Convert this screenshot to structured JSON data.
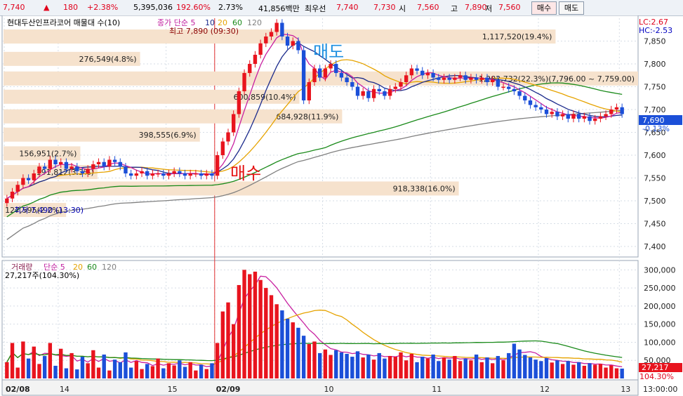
{
  "quote": {
    "price": "7,740",
    "direction": "▲",
    "change": "180",
    "change_pct": "+2.38%",
    "volume": "5,395,036",
    "volume_ratio": "192.60%",
    "turnover": "2.73%",
    "amount": "41,856백만",
    "best_label": "최우선",
    "best_ask": "7,740",
    "best_bid": "7,730",
    "open_label": "시",
    "open": "7,560",
    "high_label": "고",
    "high": "7,890",
    "low_label": "저",
    "low": "7,560"
  },
  "buttons": {
    "sell": "매수",
    "buy": "매도"
  },
  "price_panel": {
    "title": "현대두산인프라코어 매물대 수(10)",
    "ma_label": "종가 단순 5",
    "ma_periods": [
      "10",
      "20",
      "60",
      "120"
    ],
    "high_note": "최고 7,890 (09:30)",
    "low_note": "최저 7,490 (13:30)",
    "lc": "LC:2.67",
    "hc": "HC:-2.53",
    "current_price_tag": "7,690",
    "current_pct_tag": "-0.13%",
    "annotation_sell": "매도",
    "annotation_buy": "매수",
    "y_ticks": [
      "7,850",
      "7,800",
      "7,750",
      "7,700",
      "7,650",
      "7,600",
      "7,550",
      "7,500",
      "7,450",
      "7,400"
    ]
  },
  "volume_panel": {
    "title": "거래량",
    "ma_label": "단순 5",
    "ma_periods": [
      "20",
      "60",
      "120"
    ],
    "current_text": "27,217주(104.30%)",
    "tag_value": "27,217",
    "tag_pct": "104.30%",
    "y_ticks": [
      "300,000",
      "250,000",
      "200,000",
      "150,000",
      "100,000",
      "50,000"
    ]
  },
  "x_ticks": [
    "02/08",
    "14",
    "15",
    "02/09",
    "10",
    "11",
    "12",
    "13",
    "13:00:00"
  ],
  "colors": {
    "up": "#e8141e",
    "down": "#1b4fd8",
    "ma5": "#c820a0",
    "ma10": "#1c2b8c",
    "ma20": "#e6a300",
    "ma60": "#1a8a1a",
    "ma120": "#808080",
    "profile": "#f6e2cd"
  },
  "chart_data": {
    "type": "candlestick",
    "x_range": [
      "02/08",
      "13"
    ],
    "price_ylim": [
      7380,
      7900
    ],
    "volume_ylim": [
      0,
      320000
    ],
    "volume_profile": [
      {
        "label": "1,117,520(19.4%)",
        "price": 7860,
        "share_pct": 19.4
      },
      {
        "label": "276,549(4.8%)",
        "price": 7811,
        "share_pct": 4.8
      },
      {
        "label": "1,282,732(22.3%)(7,796.00 ~ 7,759.00)",
        "price": 7768,
        "share_pct": 22.3
      },
      {
        "label": "600,859(10.4%)",
        "price": 7728,
        "share_pct": 10.4
      },
      {
        "label": "684,928(11.9%)",
        "price": 7685,
        "share_pct": 11.9
      },
      {
        "label": "398,555(6.9%)",
        "price": 7645,
        "share_pct": 6.9
      },
      {
        "label": "156,951(2.7%)",
        "price": 7604,
        "share_pct": 2.7
      },
      {
        "label": "191,812(3.3%)",
        "price": 7563,
        "share_pct": 3.3
      },
      {
        "label": "918,338(16.0%)",
        "price": 7527,
        "share_pct": 16.0
      },
      {
        "label": "127,595(2.2%)",
        "price": 7480,
        "share_pct": 2.2
      }
    ],
    "close": [
      7505,
      7520,
      7535,
      7550,
      7545,
      7560,
      7575,
      7570,
      7590,
      7580,
      7585,
      7570,
      7575,
      7565,
      7560,
      7570,
      7580,
      7585,
      7575,
      7590,
      7585,
      7575,
      7560,
      7555,
      7560,
      7565,
      7555,
      7560,
      7560,
      7555,
      7560,
      7565,
      7560,
      7555,
      7560,
      7560,
      7555,
      7560,
      7555,
      7600,
      7630,
      7650,
      7690,
      7740,
      7780,
      7800,
      7820,
      7845,
      7860,
      7870,
      7890,
      7860,
      7840,
      7850,
      7830,
      7720,
      7760,
      7790,
      7770,
      7790,
      7800,
      7780,
      7770,
      7760,
      7750,
      7730,
      7740,
      7725,
      7745,
      7740,
      7730,
      7745,
      7750,
      7760,
      7775,
      7790,
      7785,
      7775,
      7780,
      7770,
      7765,
      7770,
      7765,
      7770,
      7775,
      7765,
      7770,
      7765,
      7770,
      7760,
      7765,
      7750,
      7750,
      7745,
      7740,
      7730,
      7720,
      7710,
      7705,
      7700,
      7690,
      7695,
      7685,
      7690,
      7680,
      7690,
      7680,
      7685,
      7675,
      7680,
      7685,
      7690,
      7700,
      7705,
      7690
    ],
    "volume": [
      45000,
      98000,
      30000,
      102000,
      55000,
      88000,
      40000,
      62000,
      98000,
      35000,
      82000,
      28000,
      70000,
      25000,
      60000,
      42000,
      78000,
      30000,
      66000,
      22000,
      52000,
      45000,
      72000,
      30000,
      48000,
      26000,
      40000,
      34000,
      55000,
      28000,
      42000,
      36000,
      50000,
      32000,
      45000,
      22000,
      38000,
      26000,
      42000,
      98000,
      185000,
      210000,
      150000,
      258000,
      300000,
      288000,
      295000,
      272000,
      250000,
      230000,
      205000,
      188000,
      165000,
      155000,
      140000,
      118000,
      95000,
      102000,
      70000,
      80000,
      65000,
      78000,
      72000,
      68000,
      60000,
      75000,
      58000,
      66000,
      52000,
      70000,
      55000,
      62000,
      60000,
      72000,
      50000,
      68000,
      45000,
      60000,
      55000,
      66000,
      48000,
      58000,
      52000,
      62000,
      48000,
      55000,
      50000,
      66000,
      45000,
      58000,
      42000,
      62000,
      50000,
      70000,
      96000,
      80000,
      65000,
      58000,
      52000,
      48000,
      56000,
      44000,
      50000,
      40000,
      48000,
      38000,
      45000,
      35000,
      42000,
      38000,
      40000,
      30000,
      36000,
      28000,
      27217
    ]
  }
}
